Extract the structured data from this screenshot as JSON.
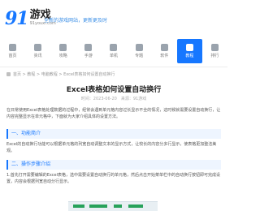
{
  "header": {
    "logo_number": "91",
    "logo_text": "游戏",
    "logo_sub": "91youxi.com",
    "slogan": "全新的游戏网站，更新更及时"
  },
  "nav": {
    "items": [
      {
        "label": "首页",
        "icon": "home-icon"
      },
      {
        "label": "资讯",
        "icon": "news-icon"
      },
      {
        "label": "攻略",
        "icon": "guide-icon"
      },
      {
        "label": "手游",
        "icon": "mobile-game-icon"
      },
      {
        "label": "单机",
        "icon": "pc-game-icon"
      },
      {
        "label": "专题",
        "icon": "topic-icon"
      },
      {
        "label": "软件",
        "icon": "software-icon"
      },
      {
        "label": "教程",
        "icon": "tutorial-icon"
      },
      {
        "label": "排行",
        "icon": "ranking-icon"
      }
    ],
    "active_index": 7
  },
  "breadcrumb": "首页 > 教程 > 电脑教程 > Excel表格如何设置自动换行",
  "article": {
    "title": "Excel表格如何设置自动换行",
    "meta": "时间：2023-06-20　来源：91游戏",
    "p1": "在日常使用Excel表格处理数据的过程中，经常会遇到单元格内容过长显示不全的情况，这时候就需要设置自动换行，让内容完整显示在单元格中，下面就为大家介绍具体的设置方法。",
    "section1": "一、功能简介",
    "p2": "Excel的自动换行功能可以根据单元格的列宽自动调整文本的显示方式，让较长的内容分多行显示，使表格更加整洁美观。",
    "section2": "二、操作步骤介绍",
    "p3": "1.首先打开需要编辑的Excel表格，选中需要设置自动换行的单元格，然后点击开始菜单栏中的自动换行按钮即可完成设置，内容会根据列宽自动分行显示。"
  },
  "colors": {
    "accent": "#1677ff",
    "section_bg": "#eef5ff"
  }
}
